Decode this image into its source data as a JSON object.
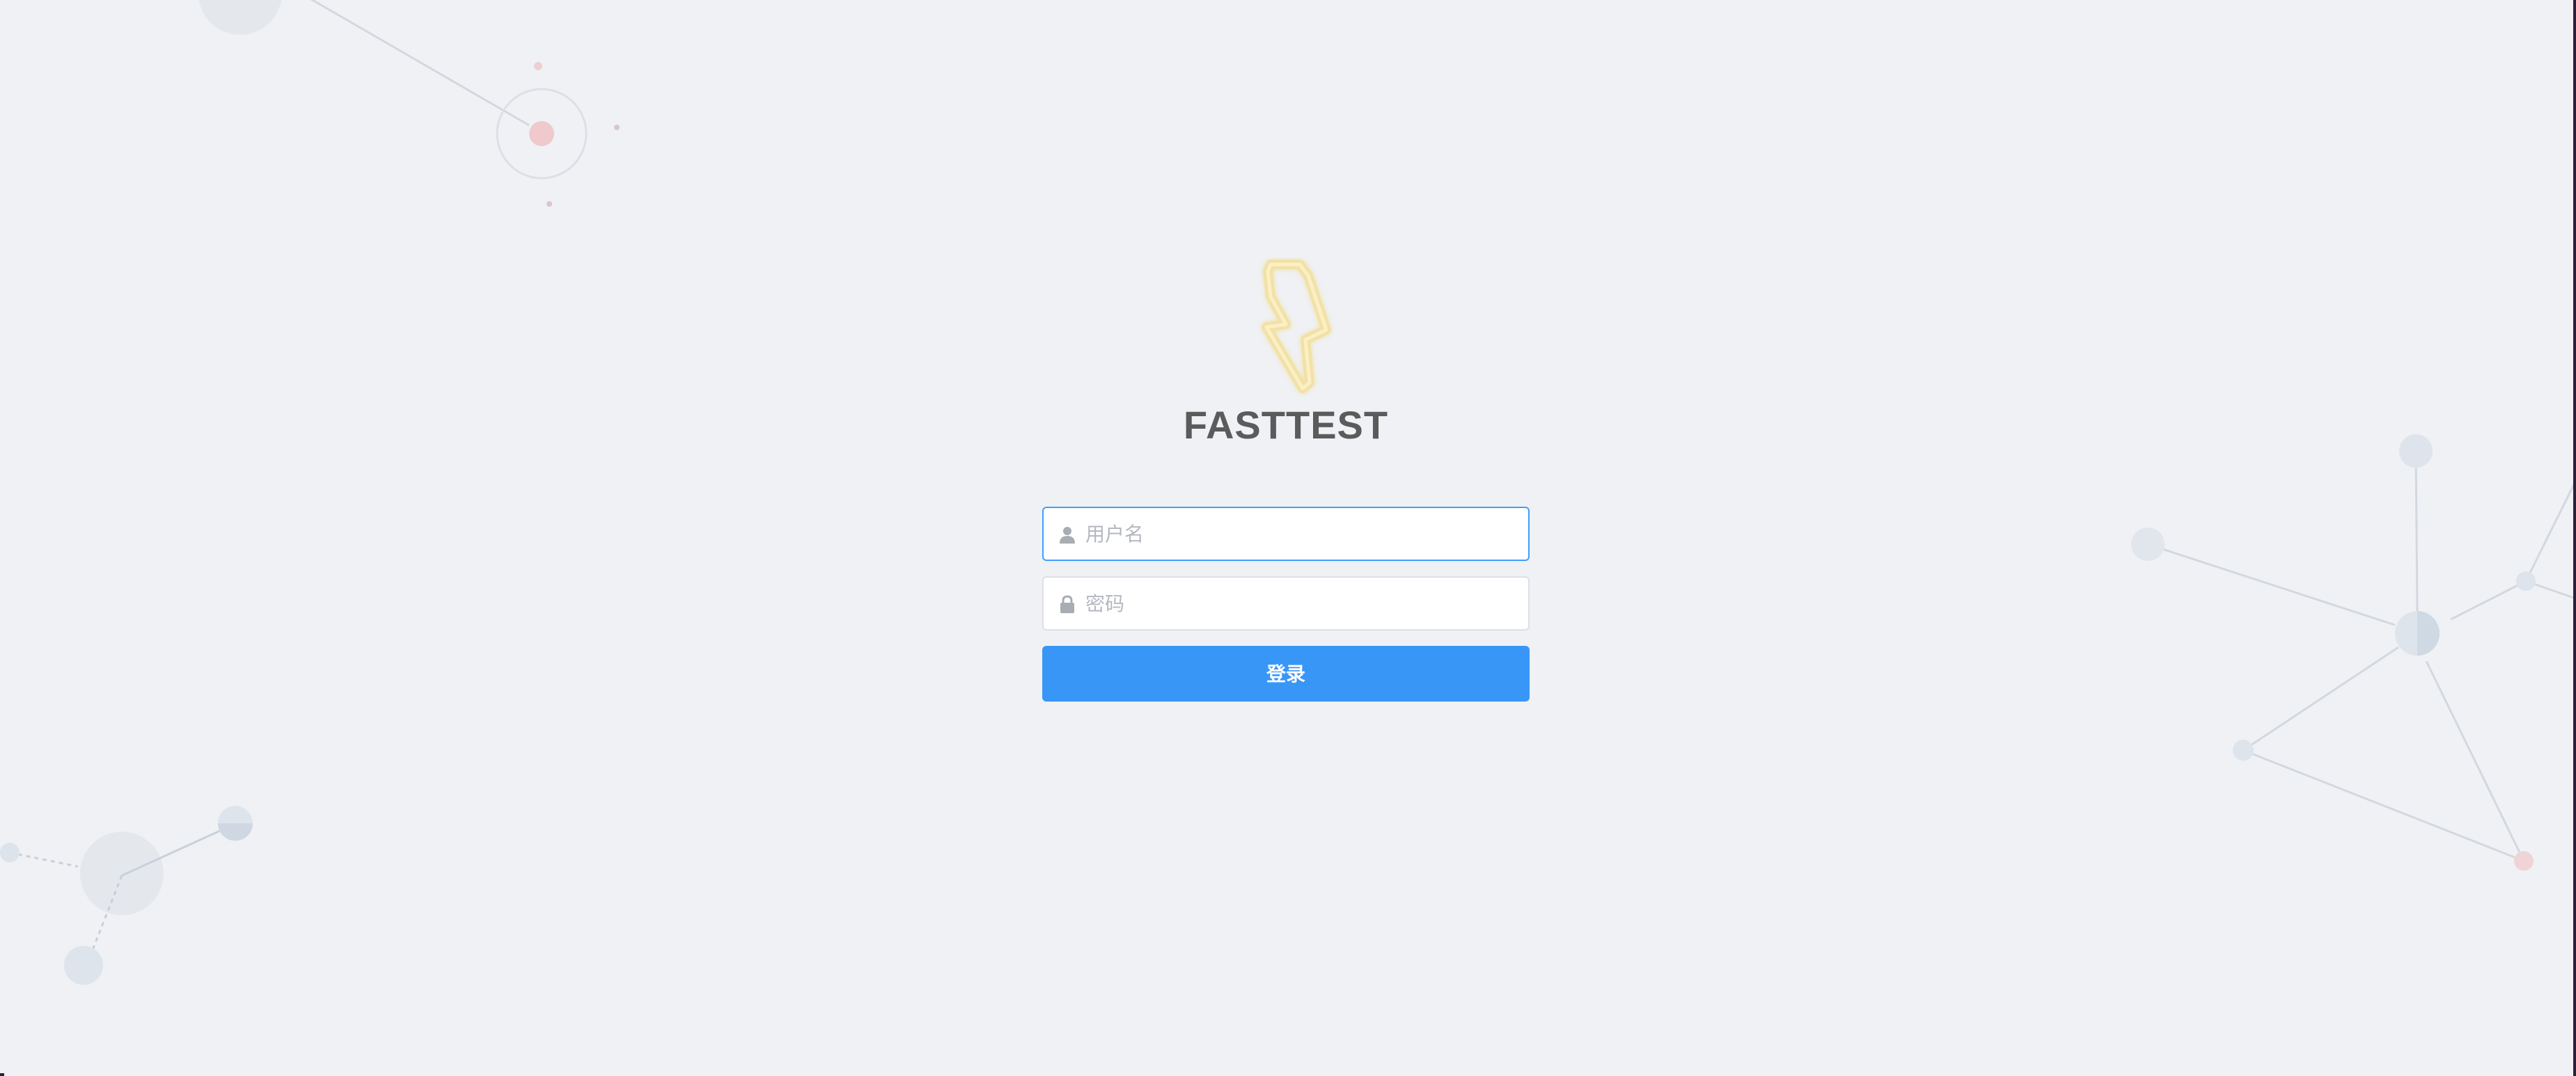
{
  "app": {
    "name": "FASTTEST",
    "logo_icon": "lightning-bolt-icon"
  },
  "login_form": {
    "username": {
      "placeholder": "用户名",
      "value": "",
      "icon": "user-icon"
    },
    "password": {
      "placeholder": "密码",
      "value": "",
      "icon": "lock-icon"
    },
    "submit_label": "登录"
  },
  "colors": {
    "background": "#eff1f5",
    "primary": "#3896f7",
    "focus_border": "#409eff",
    "title_text": "#5b5b5b",
    "logo_yellow": "#f5e19a"
  }
}
